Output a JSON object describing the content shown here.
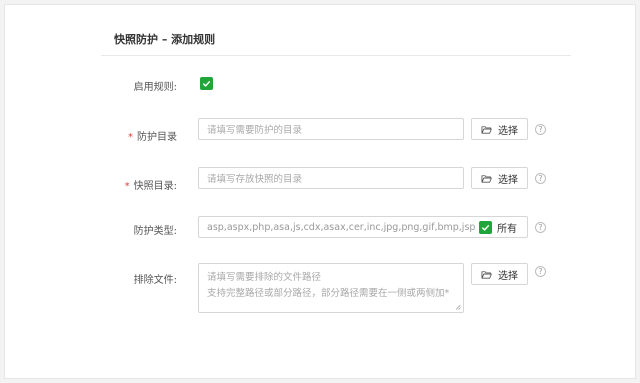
{
  "dialog": {
    "title": "快照防护 – 添加规则"
  },
  "form": {
    "enable": {
      "label": "启用规则:",
      "checked": true
    },
    "protect_dir": {
      "label": "防护目录",
      "required": true,
      "placeholder": "请填写需要防护的目录",
      "button": "选择",
      "help": "?"
    },
    "snapshot_dir": {
      "label": "快照目录:",
      "required": true,
      "placeholder": "请填写存放快照的目录",
      "button": "选择",
      "help": "?"
    },
    "protect_type": {
      "label": "防护类型:",
      "value": "asp,aspx,php,asa,js,cdx,asax,cer,inc,jpg,png,gif,bmp,jsp",
      "all_label": "所有",
      "all_checked": true,
      "help": "?"
    },
    "exclude_files": {
      "label": "排除文件:",
      "placeholder_line1": "请填写需要排除的文件路径",
      "placeholder_line2": "支持完整路径或部分路径，部分路径需要在一侧或两侧加*",
      "button": "选择",
      "help": "?"
    }
  },
  "colors": {
    "accent_green": "#20a53a",
    "required_red": "#e0403e"
  },
  "icons": {
    "folder": "folder-open-icon",
    "check": "check-icon",
    "help": "question-circle-icon"
  }
}
